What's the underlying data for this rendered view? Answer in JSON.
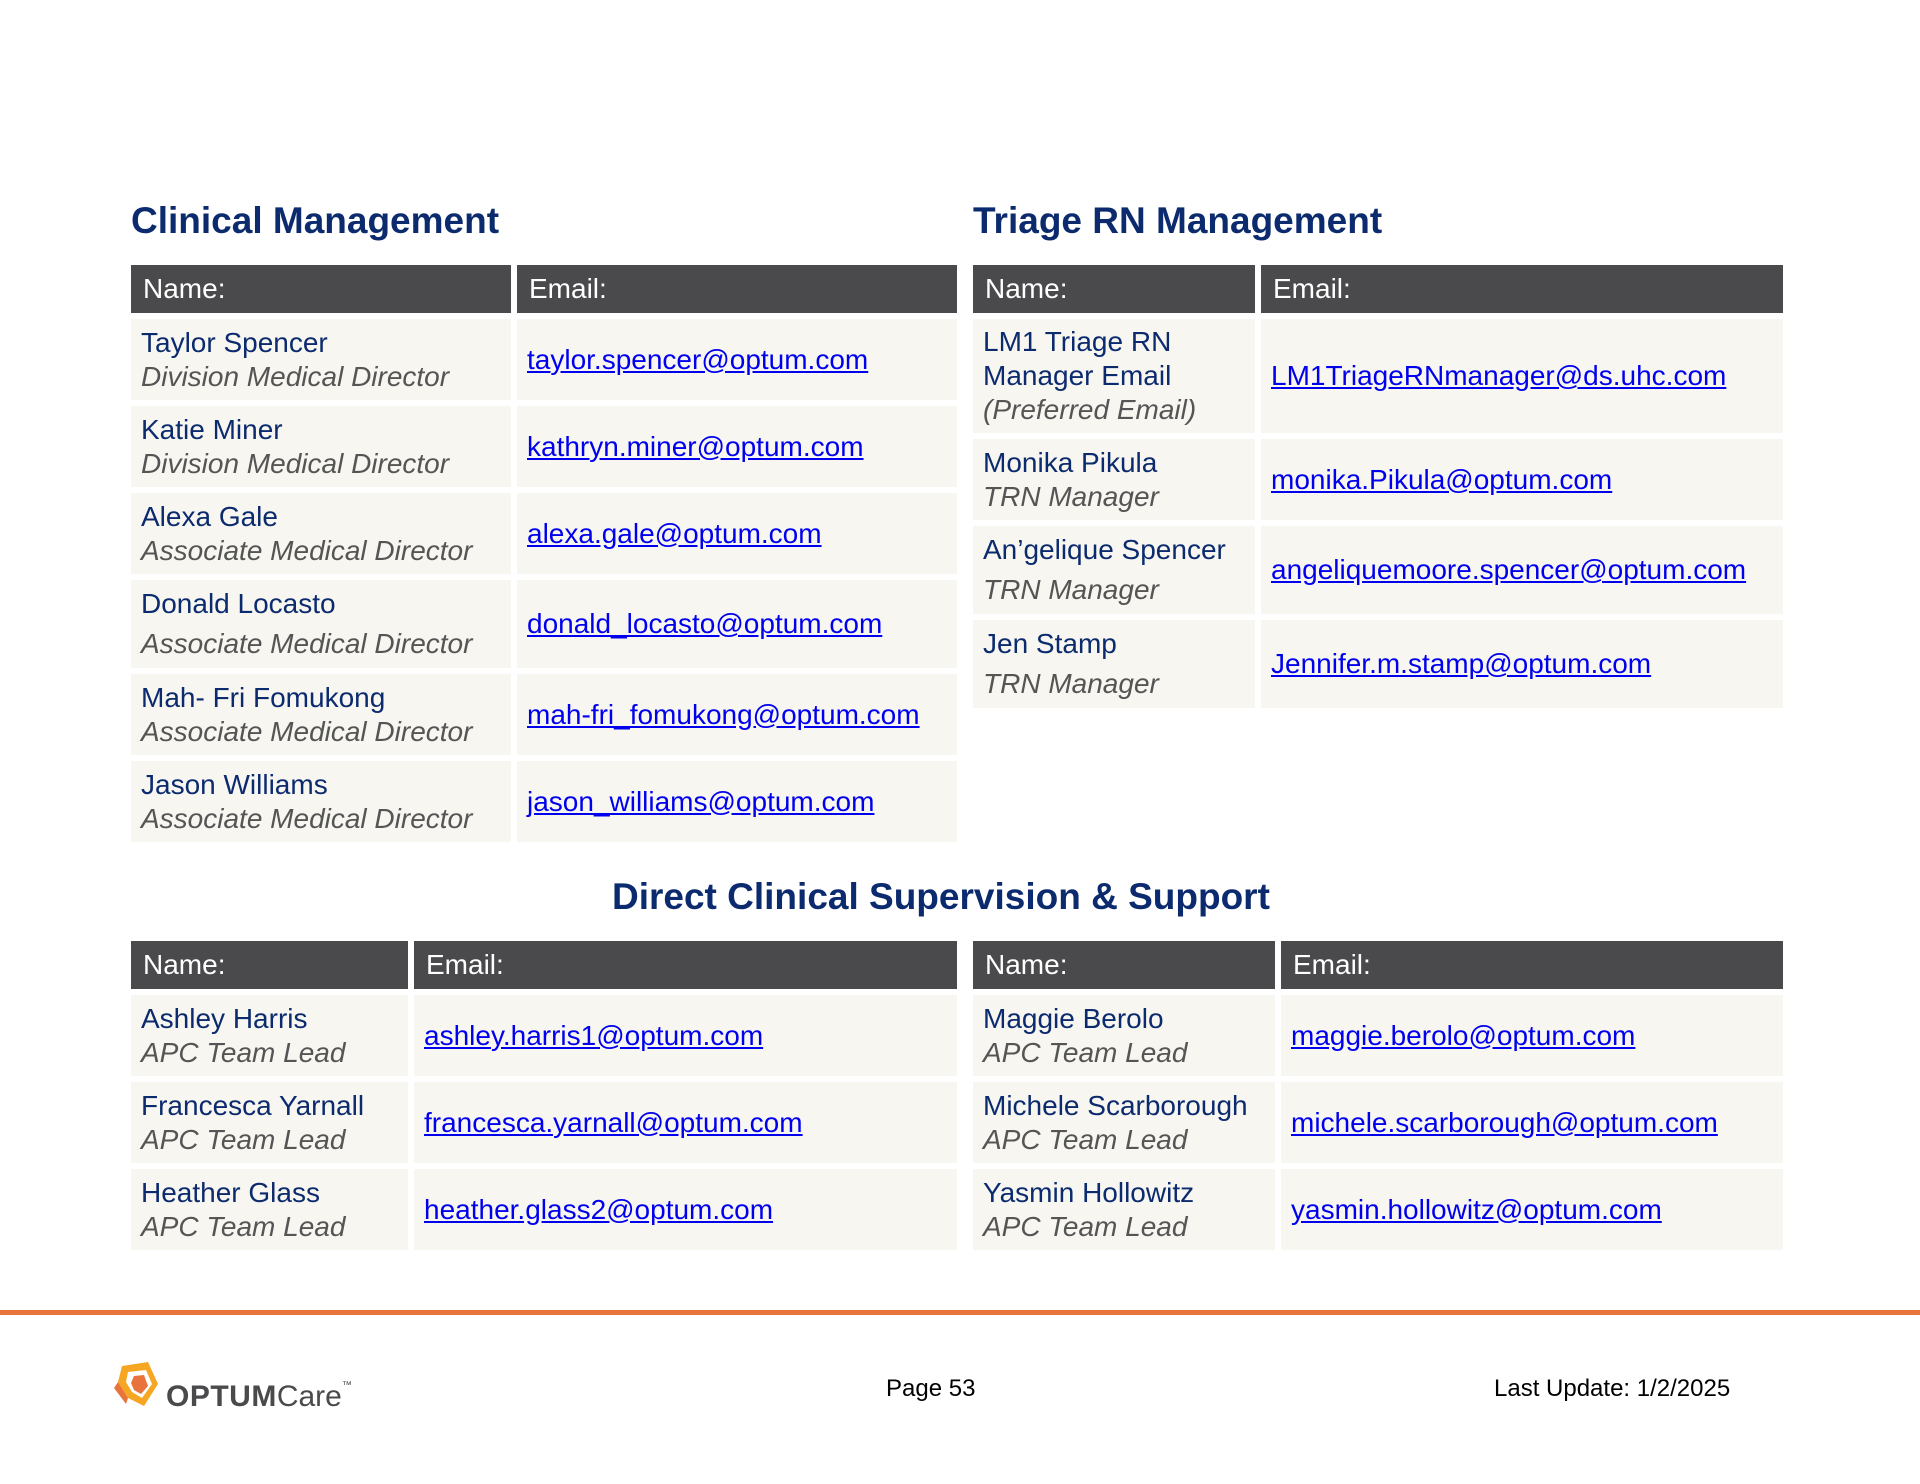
{
  "clinical_management": {
    "title": "Clinical Management",
    "headers": {
      "name": "Name:",
      "email": "Email:"
    },
    "rows": [
      {
        "name": "Taylor Spencer",
        "title": "Division Medical Director",
        "email": "taylor.spencer@optum.com"
      },
      {
        "name": "Katie Miner",
        "title": "Division Medical Director",
        "email": "kathryn.miner@optum.com"
      },
      {
        "name": "Alexa Gale",
        "title": "Associate Medical Director",
        "email": "alexa.gale@optum.com"
      },
      {
        "name": "Donald Locasto",
        "title": "Associate Medical Director",
        "email": "donald_locasto@optum.com"
      },
      {
        "name": "Mah- Fri Fomukong",
        "title": "Associate Medical Director",
        "email": "mah-fri_fomukong@optum.com"
      },
      {
        "name": "Jason Williams",
        "title": "Associate Medical Director",
        "email": "jason_williams@optum.com"
      }
    ]
  },
  "triage_management": {
    "title": "Triage RN Management",
    "headers": {
      "name": "Name:",
      "email": "Email:"
    },
    "rows": [
      {
        "name_line1": "LM1 Triage RN",
        "name_line2": "Manager Email",
        "title": "(Preferred Email)",
        "email": "LM1TriageRNmanager@ds.uhc.com"
      },
      {
        "name": "Monika Pikula",
        "title": "TRN Manager",
        "email": "monika.Pikula@optum.com"
      },
      {
        "name": "An’gelique Spencer",
        "title": "TRN Manager",
        "email": "angeliquemoore.spencer@optum.com"
      },
      {
        "name": "Jen Stamp",
        "title": "TRN Manager",
        "email": "Jennifer.m.stamp@optum.com"
      }
    ]
  },
  "direct_supervision": {
    "title": "Direct Clinical Supervision & Support",
    "headers": {
      "name": "Name:",
      "email": "Email:"
    },
    "left_rows": [
      {
        "name": "Ashley Harris",
        "title": "APC Team Lead",
        "email": "ashley.harris1@optum.com"
      },
      {
        "name": "Francesca Yarnall",
        "title": "APC Team Lead",
        "email": "francesca.yarnall@optum.com"
      },
      {
        "name": "Heather Glass",
        "title": "APC Team Lead",
        "email": "heather.glass2@optum.com"
      }
    ],
    "right_rows": [
      {
        "name": "Maggie Berolo",
        "title": "APC Team Lead",
        "email": "maggie.berolo@optum.com"
      },
      {
        "name": "Michele Scarborough",
        "title": "APC Team Lead",
        "email": "michele.scarborough@optum.com"
      },
      {
        "name": "Yasmin Hollowitz",
        "title": "APC Team Lead",
        "email": "yasmin.hollowitz@optum.com"
      }
    ]
  },
  "footer": {
    "logo_text": "OPTUM",
    "logo_care": "Care",
    "logo_tm": "™",
    "page_label": "Page 53",
    "last_update": "Last Update: 1/2/2025",
    "rule_color": "#e8743b"
  }
}
